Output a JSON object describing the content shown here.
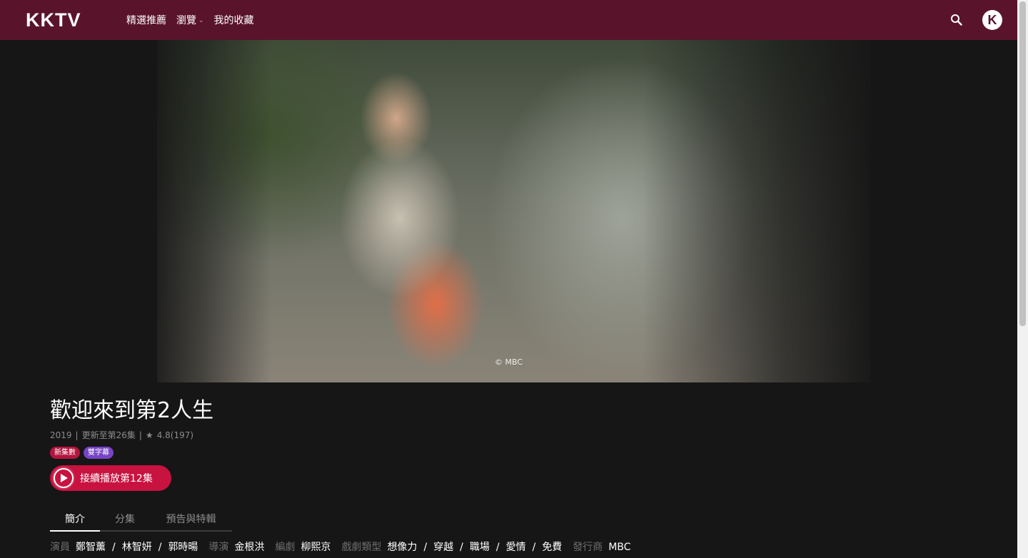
{
  "nav": {
    "logo": "KKTV",
    "items": [
      {
        "label": "精選推薦"
      },
      {
        "label": "瀏覽",
        "has_dropdown": true
      },
      {
        "label": "我的收藏"
      }
    ],
    "search_icon": "search-icon",
    "avatar_letter": "K"
  },
  "hero": {
    "copyright": "© MBC"
  },
  "show": {
    "title": "歡迎來到第2人生",
    "year": "2019",
    "update": "更新至第26集",
    "rating": "4.8(197)",
    "badges": [
      "新集數",
      "雙字幕"
    ],
    "play_label": "接續播放第12集"
  },
  "tabs": [
    "簡介",
    "分集",
    "預告與特輯"
  ],
  "active_tab": "簡介",
  "credits": {
    "cast_label": "演員",
    "cast": [
      "鄭智薰",
      "林智妍",
      "郭時暘"
    ],
    "director_label": "導演",
    "director": "金根洪",
    "writer_label": "編劇",
    "writer": "柳熙京",
    "genre_label": "戲劇類型",
    "genres": [
      "想像力",
      "穿越",
      "職場",
      "愛情",
      "免費"
    ],
    "publisher_label": "發行商",
    "publisher": "MBC"
  },
  "colors": {
    "topbar": "#59142b",
    "accent": "#c8123f",
    "badge_new": "#b3153f",
    "badge_sub": "#7744c7",
    "background": "#161616"
  }
}
